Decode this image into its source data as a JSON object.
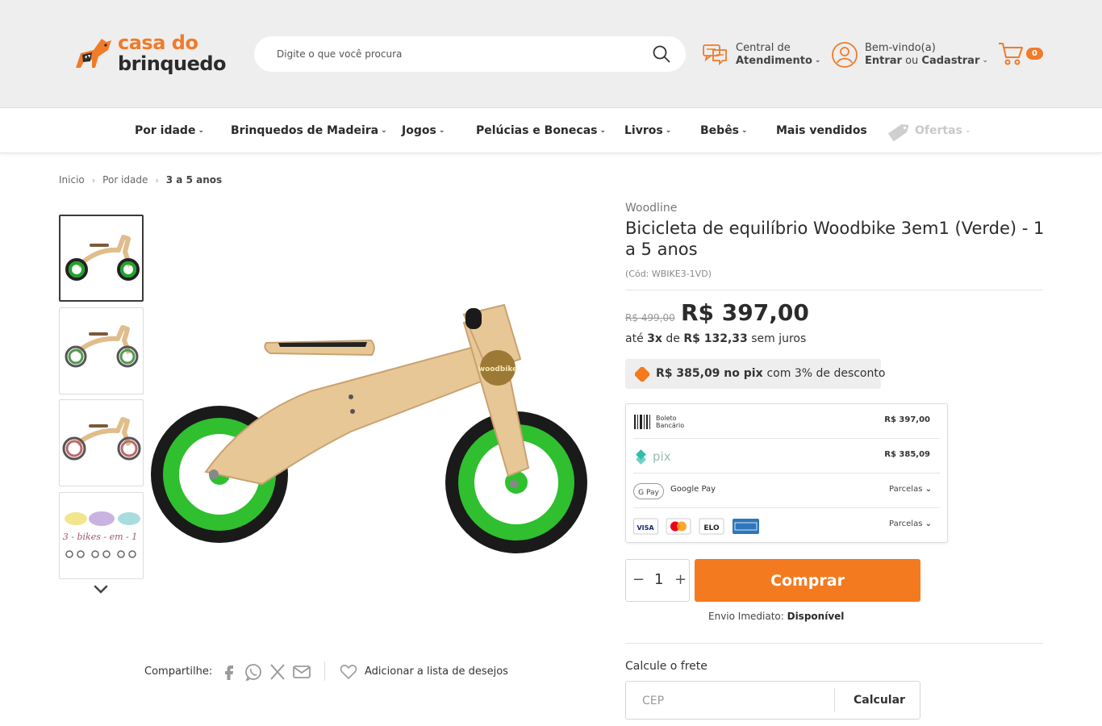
{
  "colors": {
    "accent": "#f47a20",
    "header_bg": "#eeeeee",
    "text_dark": "#2b2b2b",
    "pix_green": "#32bcad"
  },
  "header": {
    "logo_line1": "casa do",
    "logo_line2": "brinquedo",
    "search_placeholder": "Digite o que você procura",
    "help_line1": "Central de",
    "help_line2": "Atendimento",
    "account_line1": "Bem-vindo(a)",
    "account_login": "Entrar",
    "account_or": " ou ",
    "account_register": "Cadastrar",
    "cart_count": "0"
  },
  "nav": {
    "items": [
      {
        "label": "Por idade",
        "chevron": true
      },
      {
        "label": "Brinquedos de Madeira",
        "chevron": true
      },
      {
        "label": "Jogos",
        "chevron": true
      },
      {
        "label": "Pelúcias e Bonecas",
        "chevron": true
      },
      {
        "label": "Livros",
        "chevron": true
      },
      {
        "label": "Bebês",
        "chevron": true
      },
      {
        "label": "Mais vendidos",
        "chevron": false
      },
      {
        "label": "Ofertas",
        "chevron": true
      }
    ],
    "chevron_glyph": "⌄"
  },
  "breadcrumb": [
    "Inicio",
    "Por idade",
    "3 a 5 anos"
  ],
  "gallery": {
    "thumbs": [
      {
        "wheel_color": "#1fa52a",
        "active": true
      },
      {
        "wheel_color": "#3a8f3a",
        "active": false
      },
      {
        "wheel_color": "#b85a5a",
        "active": false
      },
      {
        "wheel_color": "#777777",
        "active": false,
        "caption": "3 - bikes - em - 1"
      }
    ]
  },
  "share": {
    "label": "Compartilhe:",
    "wishlist": "Adicionar a lista de desejos"
  },
  "product": {
    "brand": "Woodline",
    "title": "Bicicleta de equilíbrio Woodbike 3em1 (Verde) - 1 a 5 anos",
    "sku": "(Cód: WBIKE3-1VD)",
    "old_price": "R$ 499,00",
    "price": "R$ 397,00",
    "install_prefix": "até ",
    "install_count": "3x",
    "install_mid": " de ",
    "install_value": "R$ 132,33",
    "install_suffix": " sem juros",
    "pix_value": "R$ 385,09",
    "pix_mid": " no pix ",
    "pix_suffix": "com 3% de desconto"
  },
  "payments": [
    {
      "name": "Boleto Bancário",
      "amount": "R$ 397,00"
    },
    {
      "name": "pix",
      "amount": "R$ 385,09"
    },
    {
      "name": "Google Pay",
      "installments": "Parcelas"
    },
    {
      "name": "cards",
      "installments": "Parcelas"
    }
  ],
  "purchase": {
    "quantity": "1",
    "buy_label": "Comprar",
    "ship_label": "Envio Imediato: ",
    "ship_status": "Disponível"
  },
  "freight": {
    "label": "Calcule o frete",
    "cep_placeholder": "CEP",
    "calc_label": "Calcular"
  }
}
